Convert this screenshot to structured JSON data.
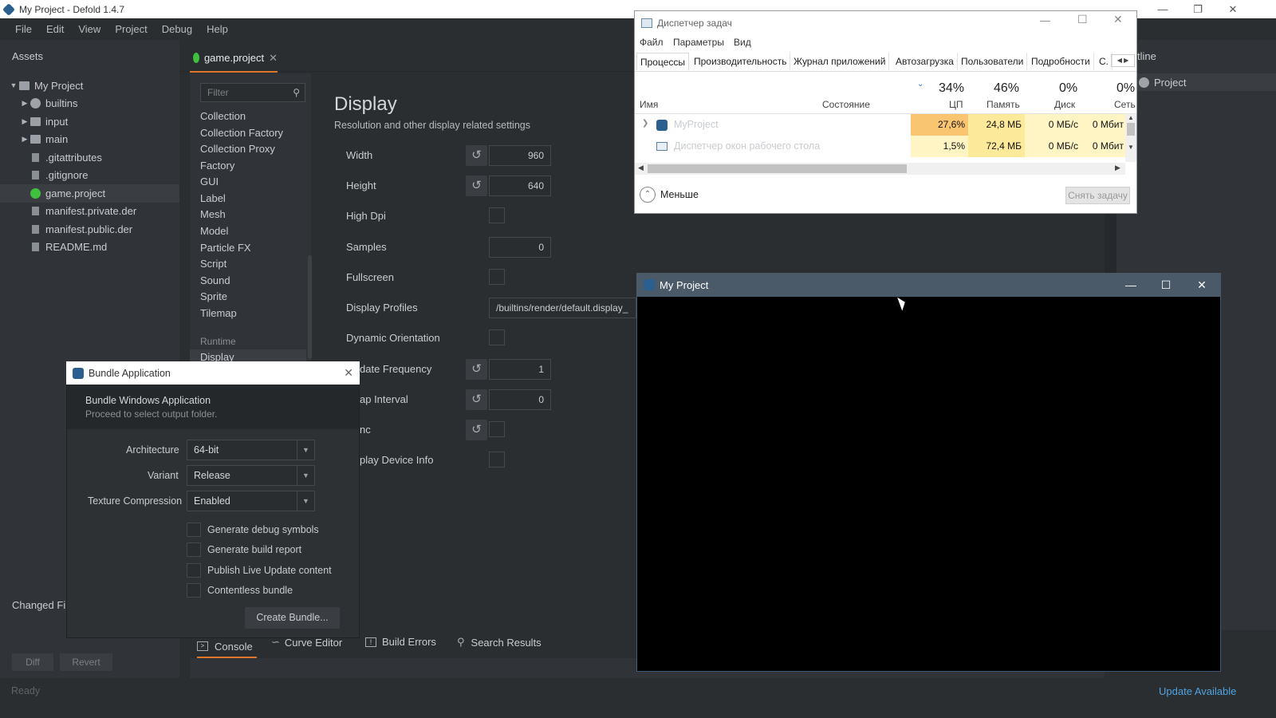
{
  "main_window": {
    "title": "My Project - Defold 1.4.7",
    "menu": [
      "File",
      "Edit",
      "View",
      "Project",
      "Debug",
      "Help"
    ]
  },
  "assets": {
    "header": "Assets",
    "tree": [
      {
        "label": "My Project",
        "type": "folder",
        "expanded": true
      },
      {
        "label": "builtins",
        "type": "gear-folder"
      },
      {
        "label": "input",
        "type": "folder"
      },
      {
        "label": "main",
        "type": "folder"
      },
      {
        "label": ".gitattributes",
        "type": "file"
      },
      {
        "label": ".gitignore",
        "type": "file"
      },
      {
        "label": "game.project",
        "type": "project",
        "selected": true
      },
      {
        "label": "manifest.private.der",
        "type": "file"
      },
      {
        "label": "manifest.public.der",
        "type": "file"
      },
      {
        "label": "README.md",
        "type": "file"
      }
    ]
  },
  "editor": {
    "tab_label": "game.project",
    "filter_placeholder": "Filter",
    "sections": [
      "Collection",
      "Collection Factory",
      "Collection Proxy",
      "Factory",
      "GUI",
      "Label",
      "Mesh",
      "Model",
      "Particle FX",
      "Script",
      "Sound",
      "Sprite",
      "Tilemap"
    ],
    "runtime_header": "Runtime",
    "runtime_selected": "Display",
    "display_title": "Display",
    "display_subtitle": "Resolution and other display related settings",
    "fields": {
      "width_label": "Width",
      "width_value": "960",
      "height_label": "Height",
      "height_value": "640",
      "highdpi_label": "High Dpi",
      "samples_label": "Samples",
      "samples_value": "0",
      "fullscreen_label": "Fullscreen",
      "profiles_label": "Display Profiles",
      "profiles_value": "/builtins/render/default.display_",
      "dynamic_label": "Dynamic Orientation",
      "update_label": "date Frequency",
      "update_value": "1",
      "swap_label": "ap Interval",
      "swap_value": "0",
      "vsync_label": "nc",
      "device_label": "play Device Info"
    }
  },
  "outline": {
    "header": "tline",
    "item": "Project"
  },
  "bottom_tabs": [
    "Console",
    "Curve Editor",
    "Build Errors",
    "Search Results"
  ],
  "changed_files": {
    "header": "Changed File",
    "diff": "Diff",
    "revert": "Revert"
  },
  "status": {
    "left": "Ready",
    "right": "Update Available"
  },
  "bundle_dialog": {
    "title": "Bundle Application",
    "heading": "Bundle Windows Application",
    "subheading": "Proceed to select output folder.",
    "architecture_label": "Architecture",
    "architecture_value": "64-bit",
    "variant_label": "Variant",
    "variant_value": "Release",
    "texture_label": "Texture Compression",
    "texture_value": "Enabled",
    "checkboxes": [
      "Generate debug symbols",
      "Generate build report",
      "Publish Live Update content",
      "Contentless bundle"
    ],
    "create_button": "Create Bundle..."
  },
  "task_manager": {
    "title": "Диспетчер задач",
    "menu": [
      "Файл",
      "Параметры",
      "Вид"
    ],
    "tabs": [
      "Процессы",
      "Производительность",
      "Журнал приложений",
      "Автозагрузка",
      "Пользователи",
      "Подробности",
      "С."
    ],
    "columns": {
      "name": "Имя",
      "status": "Состояние",
      "cpu_pct": "34%",
      "cpu": "ЦП",
      "mem_pct": "46%",
      "mem": "Память",
      "disk_pct": "0%",
      "disk": "Диск",
      "net_pct": "0%",
      "net": "Сеть"
    },
    "rows": [
      {
        "name": "MyProject",
        "cpu": "27,6%",
        "mem": "24,8 МБ",
        "disk": "0 МБ/с",
        "net": "0 Мбит"
      },
      {
        "name": "Диспетчер окон рабочего стола",
        "cpu": "1,5%",
        "mem": "72,4 МБ",
        "disk": "0 МБ/с",
        "net": "0 Мбит"
      }
    ],
    "less_label": "Меньше",
    "end_task": "Снять задачу"
  },
  "game_window": {
    "title": "My Project"
  }
}
